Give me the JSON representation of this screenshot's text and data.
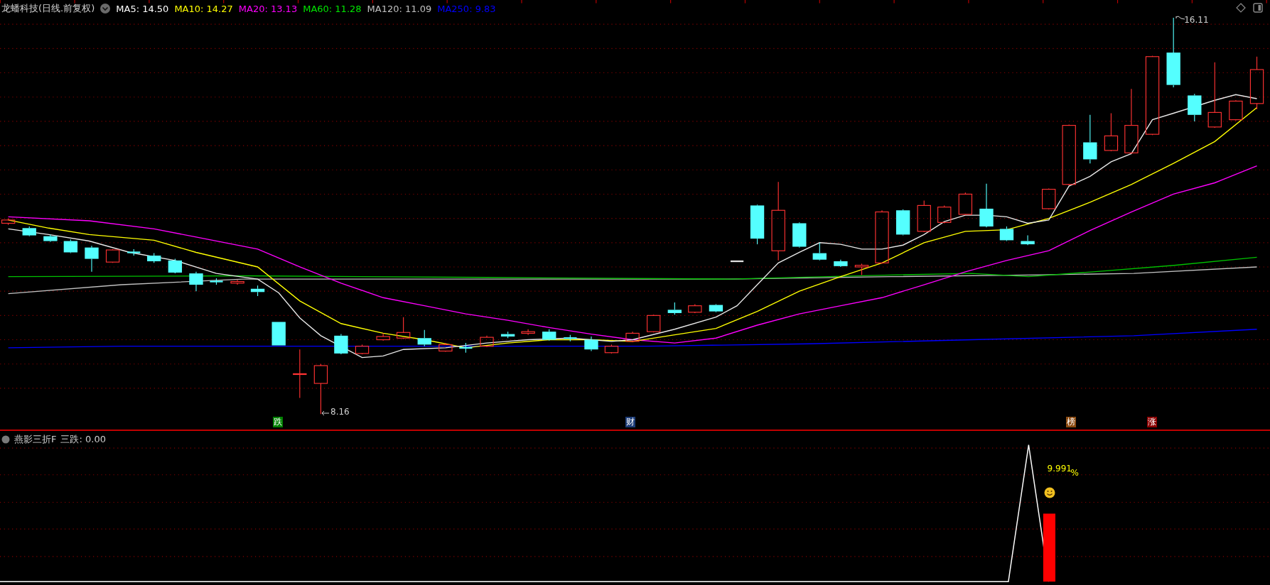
{
  "chart_header": {
    "title": "龙蟠科技(日线.前复权)",
    "ma_legend": [
      {
        "label": "MA5: 14.50",
        "color": "#ffffff"
      },
      {
        "label": "MA10: 14.27",
        "color": "#ffff00"
      },
      {
        "label": "MA20: 13.13",
        "color": "#ff00ff"
      },
      {
        "label": "MA60: 11.28",
        "color": "#00e600"
      },
      {
        "label": "MA120: 11.09",
        "color": "#c0c0c0"
      },
      {
        "label": "MA250: 9.83",
        "color": "#0000ff"
      }
    ]
  },
  "price_labels": {
    "high": "16.11",
    "low": "8.16"
  },
  "event_markers": [
    {
      "label": "跌",
      "color": "#008000"
    },
    {
      "label": "财",
      "color": "#1c3c78"
    },
    {
      "label": "榜",
      "color": "#8b4a10"
    },
    {
      "label": "涨",
      "color": "#8b0000"
    }
  ],
  "indicator": {
    "title": "燕影三折F",
    "reading": "三跌: 0.00",
    "value_label": "9.991",
    "unit": "%"
  }
}
